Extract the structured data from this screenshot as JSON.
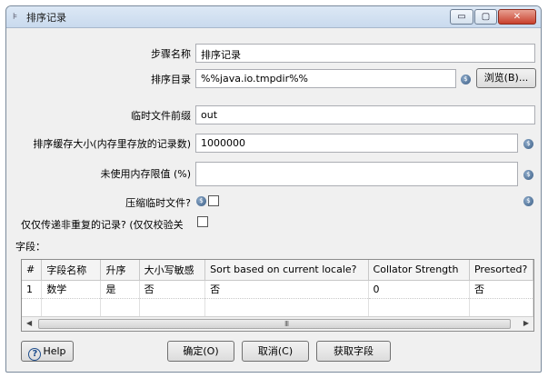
{
  "window": {
    "title": "排序记录",
    "min_glyph": "▭",
    "max_glyph": "▢",
    "close_glyph": "✕"
  },
  "form": {
    "step_name_label": "步骤名称",
    "step_name_value": "排序记录",
    "sort_dir_label": "排序目录",
    "sort_dir_value": "%%java.io.tmpdir%%",
    "browse_label": "浏览(B)...",
    "tmp_prefix_label": "临时文件前缀",
    "tmp_prefix_value": "out",
    "sort_size_label": "排序缓存大小(内存里存放的记录数)",
    "sort_size_value": "1000000",
    "free_mem_label": "未使用内存限值 (%)",
    "free_mem_value": "",
    "compress_label": "压缩临时文件?",
    "unique_label": "仅仅传递非重复的记录? (仅仅校验关",
    "fields_label": "字段："
  },
  "table": {
    "columns": [
      "#",
      "字段名称",
      "升序",
      "大小写敏感",
      "Sort based on current locale?",
      "Collator Strength",
      "Presorted?"
    ],
    "rows": [
      [
        "1",
        "数学",
        "是",
        "否",
        "否",
        "0",
        "否"
      ],
      [
        "",
        "",
        "",
        "",
        "",
        "",
        ""
      ]
    ],
    "scroll_grip": "III"
  },
  "buttons": {
    "help": "Help",
    "ok": "确定(O)",
    "cancel": "取消(C)",
    "get_fields": "获取字段"
  }
}
